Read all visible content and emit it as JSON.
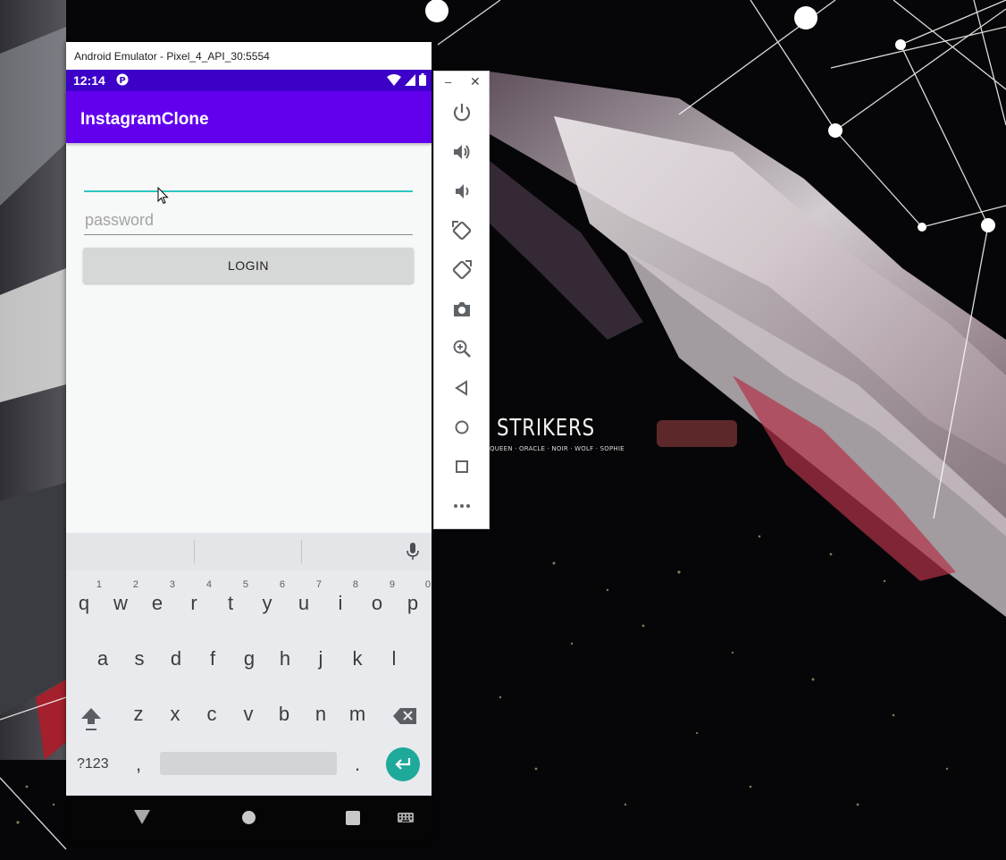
{
  "window": {
    "title": "Android Emulator - Pixel_4_API_30:5554"
  },
  "status_bar": {
    "time": "12:14"
  },
  "app": {
    "title": "InstagramClone",
    "username_value": "",
    "password_placeholder": "password",
    "login_label": "LOGIN"
  },
  "keyboard": {
    "row1": [
      {
        "key": "q",
        "hint": "1"
      },
      {
        "key": "w",
        "hint": "2"
      },
      {
        "key": "e",
        "hint": "3"
      },
      {
        "key": "r",
        "hint": "4"
      },
      {
        "key": "t",
        "hint": "5"
      },
      {
        "key": "y",
        "hint": "6"
      },
      {
        "key": "u",
        "hint": "7"
      },
      {
        "key": "i",
        "hint": "8"
      },
      {
        "key": "o",
        "hint": "9"
      },
      {
        "key": "p",
        "hint": "0"
      }
    ],
    "row2": [
      "a",
      "s",
      "d",
      "f",
      "g",
      "h",
      "j",
      "k",
      "l"
    ],
    "row3": [
      "z",
      "x",
      "c",
      "v",
      "b",
      "n",
      "m"
    ],
    "symbols_label": "?123",
    "comma": ",",
    "period": "."
  },
  "wallpaper": {
    "title": "STRIKERS",
    "subtitle": "QUEEN · ORACLE · NOIR · WOLF · SOPHIE"
  },
  "colors": {
    "status_bar": "#3c00c8",
    "app_bar": "#6200ee",
    "field_focus": "#2dc6bf",
    "enter_key": "#1fa99a"
  },
  "toolbar_icons": [
    "power-icon",
    "volume-up-icon",
    "volume-down-icon",
    "rotate-left-icon",
    "rotate-right-icon",
    "camera-icon",
    "zoom-icon",
    "back-icon",
    "home-icon",
    "overview-icon",
    "more-icon"
  ]
}
